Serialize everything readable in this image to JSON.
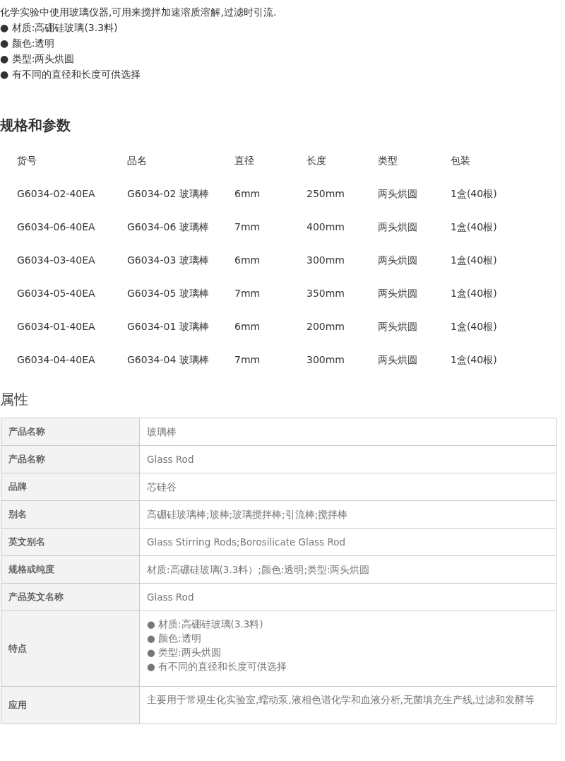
{
  "intro": {
    "text": "化学实验中使用玻璃仪器,可用来搅拌加速溶质溶解,过滤时引流.",
    "bullets": [
      "● 材质:高硼硅玻璃(3.3料)",
      "● 颜色:透明",
      "● 类型:两头烘圆",
      "● 有不同的直径和长度可供选择"
    ]
  },
  "spec_section": {
    "title": "规格和参数",
    "columns": [
      "货号",
      "品名",
      "直径",
      "长度",
      "类型",
      "包装"
    ],
    "rows": [
      [
        "G6034-02-40EA",
        "G6034-02 玻璃棒",
        "6mm",
        "250mm",
        "两头烘圆",
        "1盒(40根)"
      ],
      [
        "G6034-06-40EA",
        "G6034-06 玻璃棒",
        "7mm",
        "400mm",
        "两头烘圆",
        "1盒(40根)"
      ],
      [
        "G6034-03-40EA",
        "G6034-03 玻璃棒",
        "6mm",
        "300mm",
        "两头烘圆",
        "1盒(40根)"
      ],
      [
        "G6034-05-40EA",
        "G6034-05 玻璃棒",
        "7mm",
        "350mm",
        "两头烘圆",
        "1盒(40根)"
      ],
      [
        "G6034-01-40EA",
        "G6034-01 玻璃棒",
        "6mm",
        "200mm",
        "两头烘圆",
        "1盒(40根)"
      ],
      [
        "G6034-04-40EA",
        "G6034-04 玻璃棒",
        "7mm",
        "300mm",
        "两头烘圆",
        "1盒(40根)"
      ]
    ]
  },
  "attributes": {
    "title": "属性",
    "rows": [
      {
        "label": "产品名称",
        "kind": "text",
        "value": "玻璃棒"
      },
      {
        "label": "产品名称",
        "kind": "text",
        "value": "Glass Rod"
      },
      {
        "label": "品牌",
        "kind": "text",
        "value": "芯硅谷"
      },
      {
        "label": "别名",
        "kind": "text",
        "value": "高硼硅玻璃棒;玻棒;玻璃搅拌棒;引流棒;搅拌棒"
      },
      {
        "label": "英文别名",
        "kind": "text",
        "value": "Glass Stirring Rods;Borosilicate Glass Rod"
      },
      {
        "label": "规格或纯度",
        "kind": "text",
        "value": "材质:高硼硅玻璃(3.3料）;颜色:透明;类型:两头烘圆"
      },
      {
        "label": "产品英文名称",
        "kind": "text",
        "value": "Glass Rod"
      },
      {
        "label": "特点",
        "kind": "list",
        "items": [
          "● 材质:高硼硅玻璃(3.3料)",
          "● 颜色:透明",
          "● 类型:两头烘圆",
          "● 有不同的直径和长度可供选择"
        ]
      },
      {
        "label": "应用",
        "kind": "paragraph",
        "value": "主要用于常规生化实验室,蠕动泵,液相色谱化学和血液分析,无菌填充生产线,过滤和发酵等"
      }
    ]
  }
}
